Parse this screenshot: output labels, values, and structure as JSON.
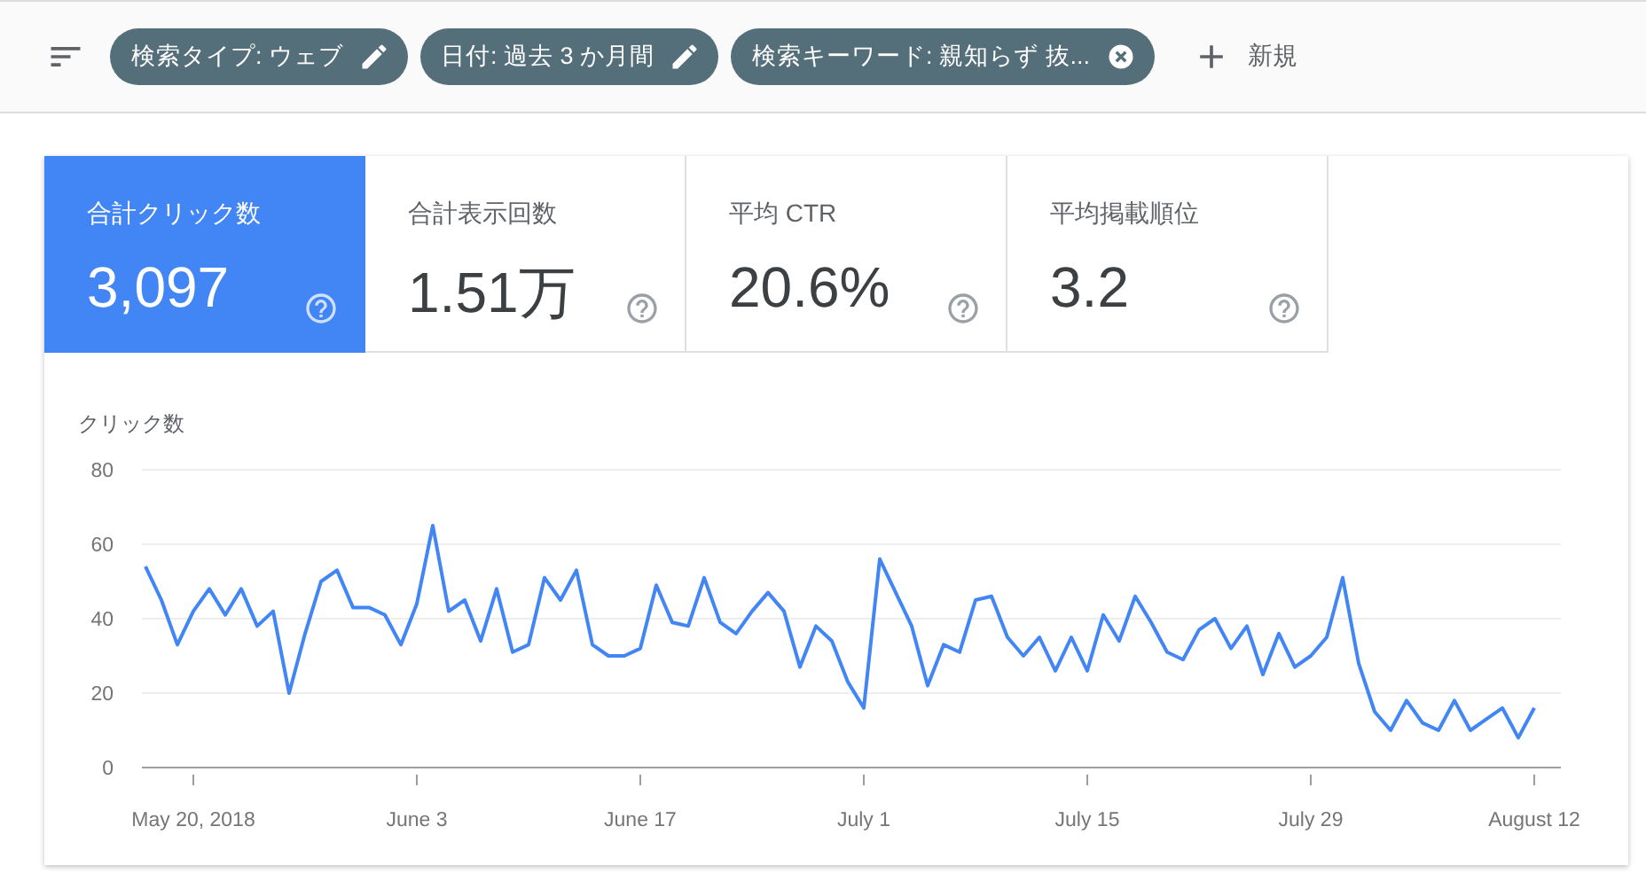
{
  "filters": [
    {
      "label": "検索タイプ: ウェブ",
      "kind": "edit"
    },
    {
      "label": "日付: 過去 3 か月間",
      "kind": "edit"
    },
    {
      "label": "検索キーワード: 親知らず 抜...",
      "kind": "remove"
    }
  ],
  "new_button": "新規",
  "metrics": [
    {
      "label": "合計クリック数",
      "value": "3,097",
      "selected": true
    },
    {
      "label": "合計表示回数",
      "value": "1.51万",
      "selected": false
    },
    {
      "label": "平均 CTR",
      "value": "20.6%",
      "selected": false
    },
    {
      "label": "平均掲載順位",
      "value": "3.2",
      "selected": false
    }
  ],
  "chart": {
    "chart_data": {
      "type": "line",
      "ylabel": "クリック数",
      "ylim": [
        0,
        80
      ],
      "grid": true,
      "yticks": [
        0,
        20,
        40,
        60,
        80
      ],
      "categories": [
        null,
        null,
        null,
        "May 20, 2018",
        null,
        null,
        null,
        null,
        null,
        null,
        null,
        null,
        null,
        null,
        null,
        null,
        null,
        "June 3",
        null,
        null,
        null,
        null,
        null,
        null,
        null,
        null,
        null,
        null,
        null,
        null,
        null,
        "June 17",
        null,
        null,
        null,
        null,
        null,
        null,
        null,
        null,
        null,
        null,
        null,
        null,
        null,
        "July 1",
        null,
        null,
        null,
        null,
        null,
        null,
        null,
        null,
        null,
        null,
        null,
        null,
        null,
        "July 15",
        null,
        null,
        null,
        null,
        null,
        null,
        null,
        null,
        null,
        null,
        null,
        null,
        null,
        "July 29",
        null,
        null,
        null,
        null,
        null,
        null,
        null,
        null,
        null,
        null,
        null,
        null,
        null,
        "August 12"
      ],
      "series": [
        {
          "color": "#4285f4",
          "values": [
            54,
            45,
            33,
            42,
            48,
            41,
            48,
            38,
            42,
            20,
            36,
            50,
            53,
            43,
            43,
            41,
            33,
            44,
            65,
            42,
            45,
            34,
            48,
            31,
            33,
            51,
            45,
            53,
            33,
            30,
            30,
            32,
            49,
            39,
            38,
            51,
            39,
            36,
            42,
            47,
            42,
            27,
            38,
            34,
            23,
            16,
            56,
            47,
            38,
            22,
            33,
            31,
            45,
            46,
            35,
            30,
            35,
            26,
            35,
            26,
            41,
            34,
            46,
            39,
            31,
            29,
            37,
            40,
            32,
            38,
            25,
            36,
            27,
            30,
            35,
            51,
            28,
            15,
            10,
            18,
            12,
            10,
            18,
            10,
            13,
            16,
            8,
            16
          ]
        }
      ]
    }
  }
}
